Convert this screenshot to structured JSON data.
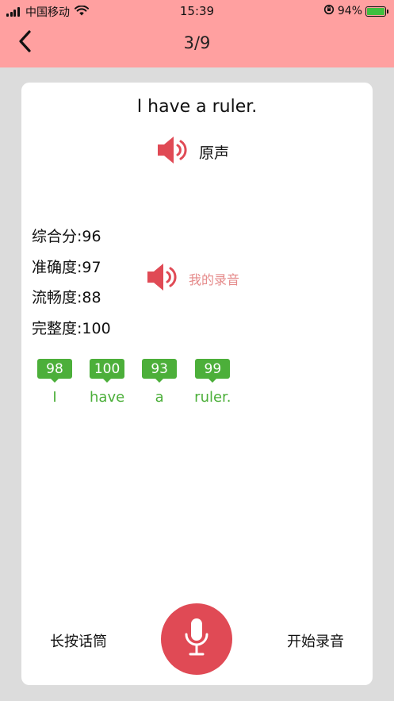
{
  "status_bar": {
    "carrier": "中国移动",
    "time": "15:39",
    "battery": "94%",
    "battery_level": 0.94
  },
  "nav": {
    "title": "3/9",
    "back_icon": "chevron-left-icon"
  },
  "card": {
    "sentence": "I have a ruler.",
    "original_audio_label": "原声",
    "my_recording_label": "我的录音",
    "scores": [
      {
        "label": "综合分:96"
      },
      {
        "label": "准确度:97"
      },
      {
        "label": "流畅度:88"
      },
      {
        "label": "完整度:100"
      }
    ],
    "words": [
      {
        "score": "98",
        "word": "I"
      },
      {
        "score": "100",
        "word": "have"
      },
      {
        "score": "93",
        "word": "a"
      },
      {
        "score": "99",
        "word": "ruler."
      }
    ]
  },
  "bottom": {
    "hold_label": "长按话筒",
    "start_label": "开始录音",
    "mic_icon": "microphone-icon"
  },
  "colors": {
    "header": "#ffa0a0",
    "speaker": "#e04a55",
    "word_score": "#4caf3a",
    "mic_button": "#e04a55"
  }
}
